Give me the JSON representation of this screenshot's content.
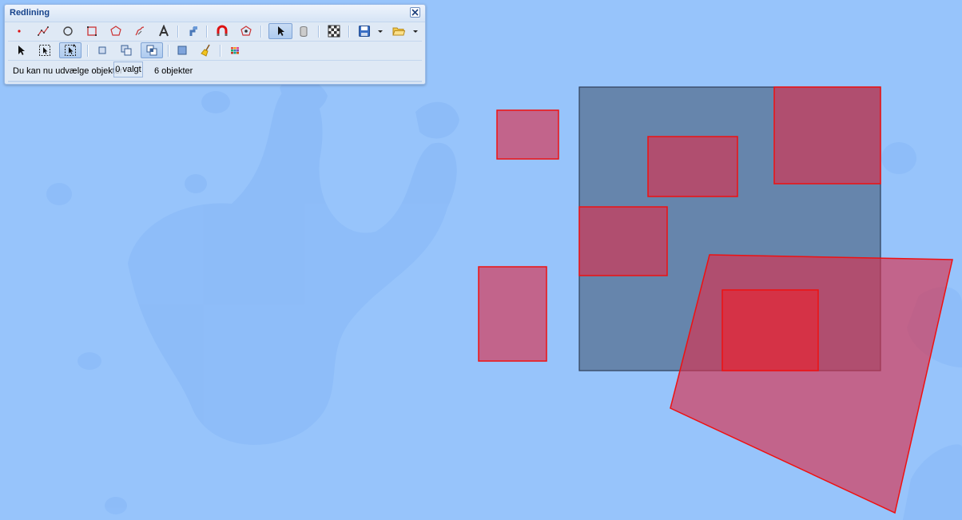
{
  "panel": {
    "title": "Redlining",
    "close_icon": "close-icon"
  },
  "toolbar_row1": {
    "tools": [
      "point-icon",
      "polyline-icon",
      "circle-icon",
      "rectangle-icon",
      "polygon-icon",
      "freehand-icon",
      "text-icon",
      "snap-icon",
      "magnet-icon",
      "edit-vertices-icon",
      "select-arrow-icon",
      "eraser-icon",
      "grid-icon",
      "save-icon",
      "save-dropdown-icon",
      "open-folder-icon",
      "open-dropdown-icon"
    ],
    "active_tool": "select-arrow-icon"
  },
  "toolbar_row2": {
    "tools": [
      "pointer-icon",
      "box-select-icon",
      "box-select-plus-icon",
      "square-icon",
      "stack-icon",
      "layered-stack-icon",
      "fill-square-icon",
      "broom-icon",
      "palette-icon"
    ],
    "active_tools": [
      "box-select-plus-icon",
      "layered-stack-icon"
    ]
  },
  "status": {
    "message": "Du kan nu udvælge objekter",
    "selected": "0 valgt",
    "count": "6 objekter"
  },
  "colors": {
    "panel_background": "#dfe9f5",
    "title_color": "#15428b",
    "map_background": "#97c4fb",
    "feature_fill": "#d9314f",
    "feature_stroke": "#ee1111",
    "selection_fill": "#5a7698",
    "selection_stroke": "#2e3e58"
  }
}
